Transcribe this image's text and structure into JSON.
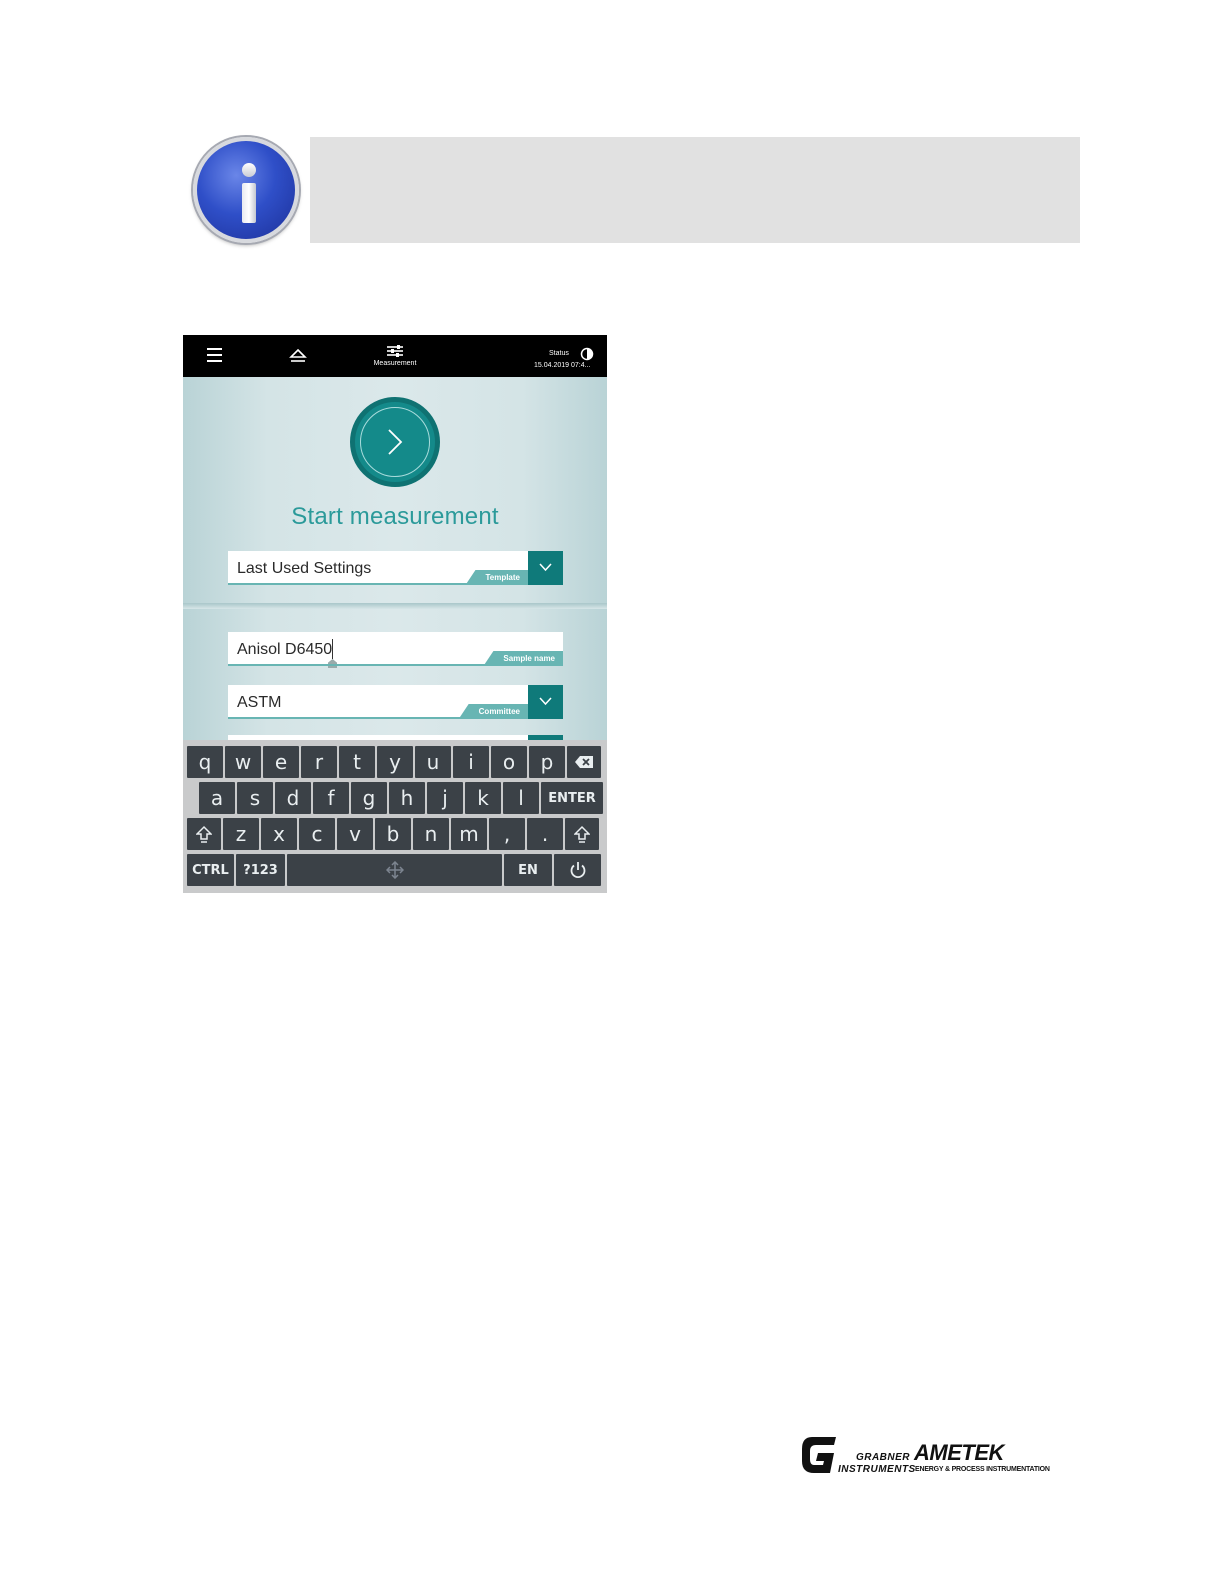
{
  "screen": {
    "topbar": {
      "measurement_label": "Measurement",
      "status_label": "Status",
      "status_date": "15.04.2019 07:4..."
    },
    "start_title": "Start measurement",
    "fields": {
      "template": {
        "value": "Last Used Settings",
        "tag": "Template"
      },
      "sample_name": {
        "value": "Anisol D6450",
        "tag": "Sample name"
      },
      "committee": {
        "value": "ASTM",
        "tag": "Committee"
      }
    },
    "accent_color": "#148a8a",
    "keyboard": {
      "row1": [
        "q",
        "w",
        "e",
        "r",
        "t",
        "y",
        "u",
        "i",
        "o",
        "p"
      ],
      "row2": [
        "a",
        "s",
        "d",
        "f",
        "g",
        "h",
        "j",
        "k",
        "l"
      ],
      "row3": [
        "z",
        "x",
        "c",
        "v",
        "b",
        "n",
        "m",
        ",",
        "."
      ],
      "enter_label": "ENTER",
      "ctrl_label": "CTRL",
      "symbols_label": "?123",
      "lang_label": "EN"
    }
  },
  "logos": {
    "grabner": "GRABNER INSTRUMENTS",
    "ametek": "AMETEK",
    "ametek_sub": "ENERGY & PROCESS INSTRUMENTATION"
  }
}
